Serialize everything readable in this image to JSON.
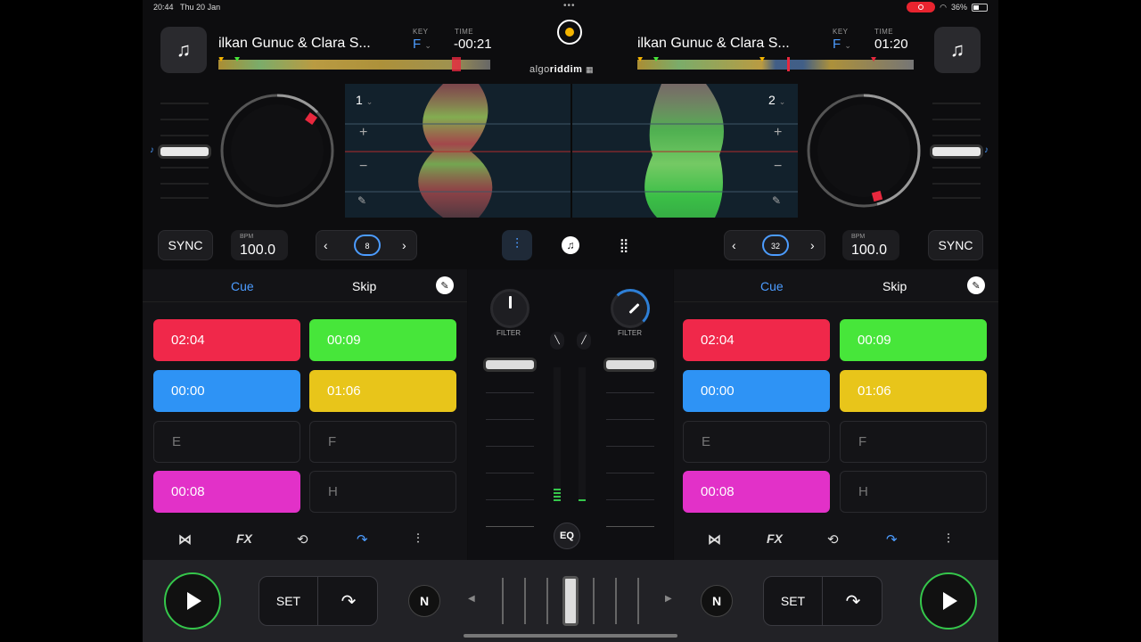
{
  "status": {
    "time": "20:44",
    "date": "Thu 20 Jan",
    "battery": "36%"
  },
  "decks": {
    "left": {
      "title": "ilkan Gunuc & Clara S...",
      "key_label": "KEY",
      "key": "F",
      "time_label": "TIME",
      "time": "-00:21",
      "deck_number": "1",
      "bpm_label": "BPM",
      "bpm": "100.0",
      "loop_size": "8",
      "sync": "SYNC"
    },
    "right": {
      "title": "ilkan Gunuc & Clara S...",
      "key_label": "KEY",
      "key": "F",
      "time_label": "TIME",
      "time": "01:20",
      "deck_number": "2",
      "bpm_label": "BPM",
      "bpm": "100.0",
      "loop_size": "32",
      "sync": "SYNC"
    }
  },
  "logo": {
    "light": "algo",
    "bold": "riddim"
  },
  "pads_panel": {
    "tab_cue": "Cue",
    "tab_skip": "Skip",
    "pads": [
      "02:04",
      "00:09",
      "00:00",
      "01:06",
      "E",
      "F",
      "00:08",
      "H"
    ],
    "pad_colors": [
      "#f0284a",
      "#47e63a",
      "#2e93f5",
      "#e8c51a",
      null,
      null,
      "#e231c8",
      null
    ]
  },
  "mixer": {
    "filter_label": "FILTER",
    "eq": "EQ"
  },
  "bottom": {
    "set": "SET",
    "n_label": "N"
  },
  "colors": {
    "accent": "#4c9cff",
    "play": "#35c74b",
    "cue_marker": "#e8283e"
  }
}
